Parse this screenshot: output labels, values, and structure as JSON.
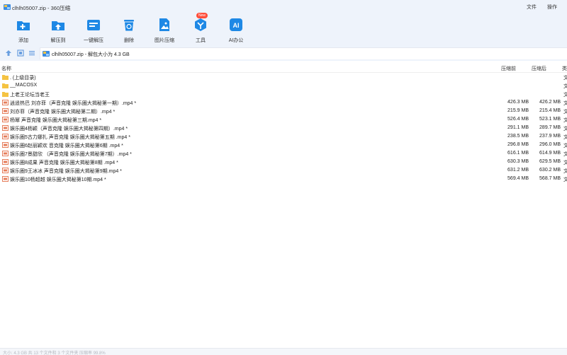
{
  "window": {
    "title": "clhlh05007.zip - 360压缩",
    "menu": [
      "文件",
      "操作"
    ]
  },
  "toolbar": {
    "tools": [
      {
        "label": "添加",
        "icon": "add-icon"
      },
      {
        "label": "解压到",
        "icon": "extract-to-icon"
      },
      {
        "label": "一键解压",
        "icon": "one-click-extract-icon"
      },
      {
        "label": "删除",
        "icon": "delete-icon"
      },
      {
        "label": "图片压缩",
        "icon": "image-compress-icon"
      },
      {
        "label": "工具",
        "icon": "tools-icon",
        "badge": "New"
      },
      {
        "label": "AI办公",
        "icon": "ai-office-icon"
      }
    ]
  },
  "address": {
    "path": "clhlh05007.zip - 解包大小为 4.3 GB"
  },
  "columns": {
    "name": "名称",
    "compressed": "压缩前",
    "original": "压缩后",
    "type": "类"
  },
  "rows": [
    {
      "name": ". (上级目录)",
      "kind": "folder",
      "compressed": "",
      "original": "",
      "type": "文"
    },
    {
      "name": "__MACOSX",
      "kind": "folder",
      "compressed": "",
      "original": "",
      "type": "文"
    },
    {
      "name": "上老王论坛当老王",
      "kind": "folder",
      "compressed": "",
      "original": "",
      "type": "文"
    },
    {
      "name": "逍遥热巴  刘亦菲（声音克隆  娱乐圈大揭秘第一期）.mp4 *",
      "kind": "video",
      "compressed": "426.3 MB",
      "original": "426.2 MB",
      "type": "文"
    },
    {
      "name": "刘亦菲（声音克隆  娱乐圈大揭秘第二期）.mp4 *",
      "kind": "video",
      "compressed": "215.9 MB",
      "original": "215.4 MB",
      "type": "文"
    },
    {
      "name": "杨幂  声音克隆  娱乐圈大揭秘第三期.mp4 *",
      "kind": "video",
      "compressed": "526.4 MB",
      "original": "523.1 MB",
      "type": "文"
    },
    {
      "name": "娱乐圈4杨颖（声音克隆  娱乐圈大揭秘第四期）.mp4 *",
      "kind": "video",
      "compressed": "291.1 MB",
      "original": "289.7 MB",
      "type": "文"
    },
    {
      "name": "娱乐圈5古力娜扎  声音克隆  娱乐圈大揭秘第五期 .mp4 *",
      "kind": "video",
      "compressed": "238.5 MB",
      "original": "237.9 MB",
      "type": "文"
    },
    {
      "name": "娱乐圈6赵丽颖欢 音克隆  娱乐圈大揭秘第6期 .mp4 *",
      "kind": "video",
      "compressed": "296.8 MB",
      "original": "296.0 MB",
      "type": "文"
    },
    {
      "name": "娱乐圈7景甜欣 （声音克隆  娱乐圈大揭秘第7期）.mp4 *",
      "kind": "video",
      "compressed": "616.1 MB",
      "original": "614.9 MB",
      "type": "文"
    },
    {
      "name": "娱乐圈8成果 声音克隆  娱乐圈大揭秘第8期 .mp4 *",
      "kind": "video",
      "compressed": "630.3 MB",
      "original": "629.5 MB",
      "type": "文"
    },
    {
      "name": "娱乐圈9王冰冰  声音克隆  娱乐圈大揭秘第9期.mp4 *",
      "kind": "video",
      "compressed": "631.2 MB",
      "original": "630.2 MB",
      "type": "文"
    },
    {
      "name": "娱乐圈10杨超越  娱乐圈大揭秘第10期.mp4 *",
      "kind": "video",
      "compressed": "569.4 MB",
      "original": "568.7 MB",
      "type": "文"
    }
  ],
  "status": {
    "text": "大小: 4.3 GB 共 13 个文件和 3 个文件夹 压缩率 99.8%"
  },
  "colors": {
    "chrome": "#eef3fb",
    "accent": "#1e88e5",
    "folder": "#f5c342",
    "video_icon": "#e57c5a",
    "badge": "#ff4d3a"
  }
}
